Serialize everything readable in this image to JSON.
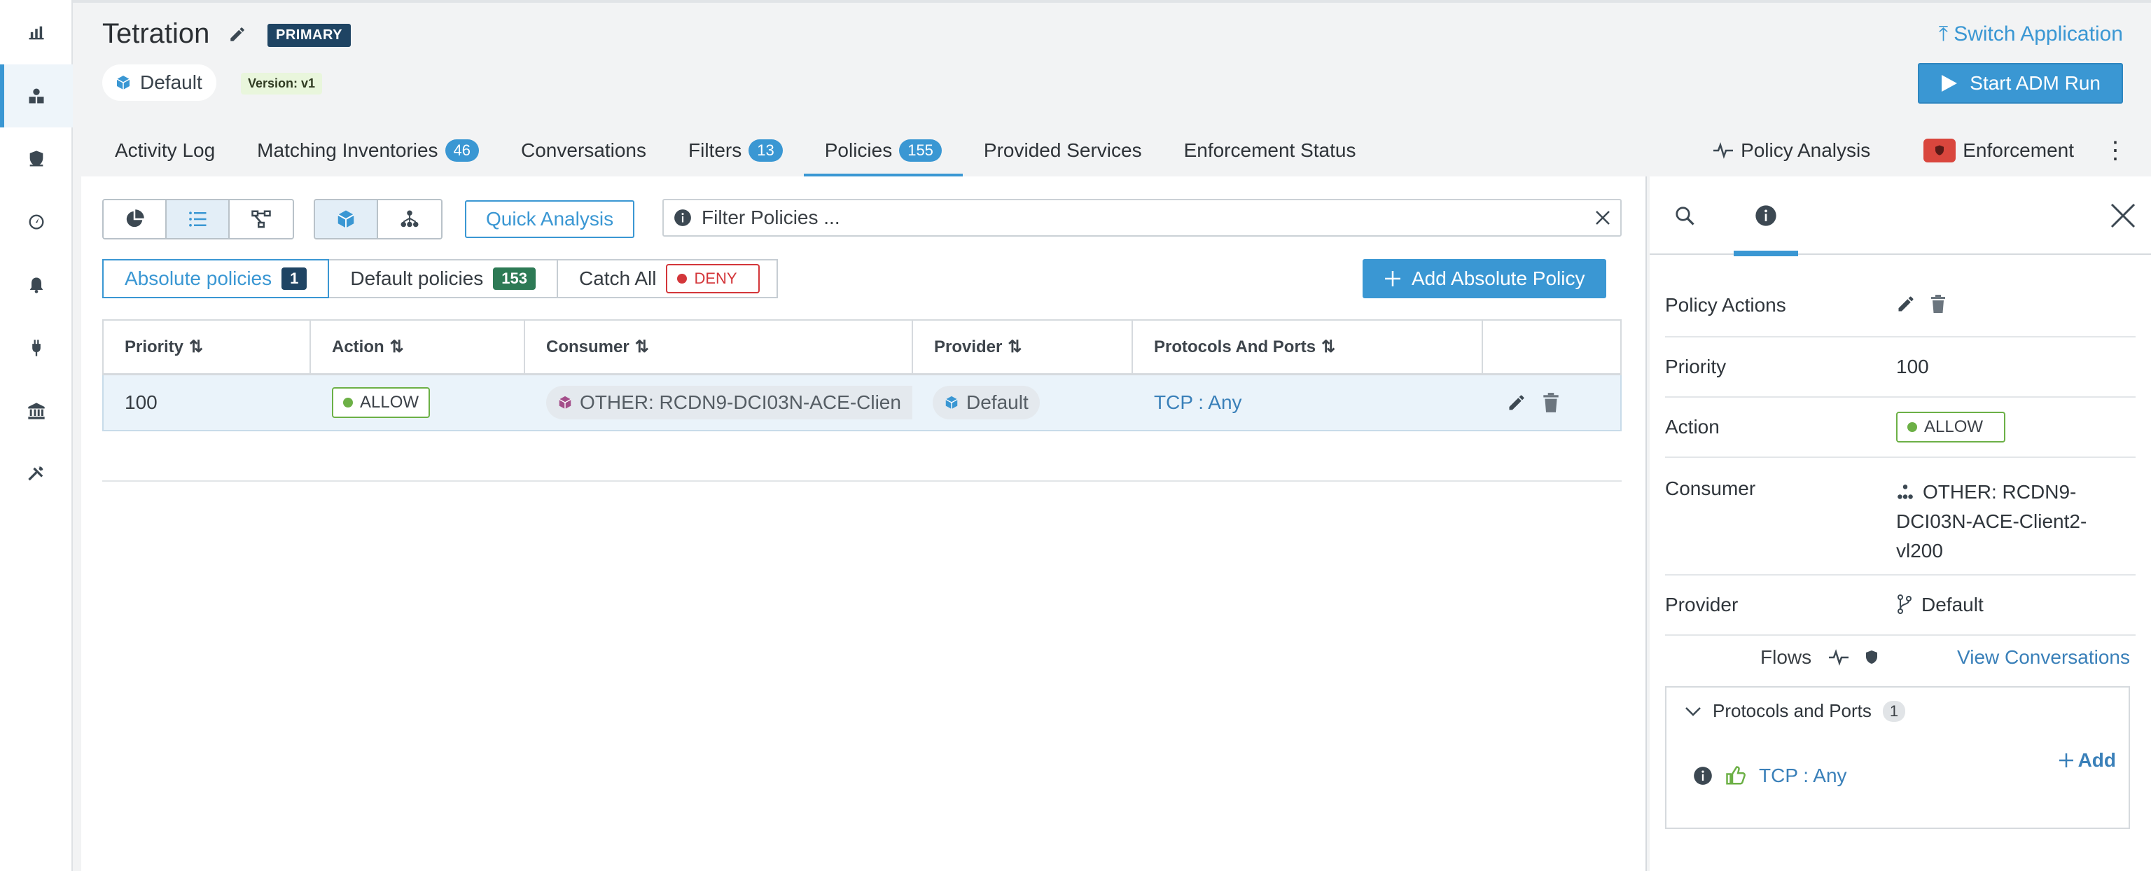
{
  "header": {
    "app_name": "Tetration",
    "primary_badge": "PRIMARY",
    "scope": "Default",
    "version": "Version: v1",
    "switch_app": "Switch Application",
    "start_adm": "Start ADM Run"
  },
  "tabs": [
    {
      "label": "Activity Log"
    },
    {
      "label": "Matching Inventories",
      "count": "46"
    },
    {
      "label": "Conversations"
    },
    {
      "label": "Filters",
      "count": "13"
    },
    {
      "label": "Policies",
      "count": "155"
    },
    {
      "label": "Provided Services"
    },
    {
      "label": "Enforcement Status"
    }
  ],
  "tabs_right": {
    "policy_analysis": "Policy Analysis",
    "enforcement": "Enforcement"
  },
  "toolbar": {
    "quick_analysis": "Quick Analysis",
    "filter_placeholder": "Filter Policies ..."
  },
  "policy_tabs": {
    "absolute": "Absolute policies",
    "absolute_count": "1",
    "default": "Default policies",
    "default_count": "153",
    "catch_all": "Catch All",
    "catch_all_value": "DENY",
    "add_button": "Add Absolute Policy"
  },
  "table": {
    "headers": [
      "Priority",
      "Action",
      "Consumer",
      "Provider",
      "Protocols And Ports"
    ],
    "rows": [
      {
        "priority": "100",
        "action": "ALLOW",
        "consumer": "OTHER: RCDN9-DCI03N-ACE-Clien",
        "provider": "Default",
        "ports": "TCP : Any"
      }
    ]
  },
  "detail": {
    "policy_actions_label": "Policy Actions",
    "priority_label": "Priority",
    "priority": "100",
    "action_label": "Action",
    "action": "ALLOW",
    "consumer_label": "Consumer",
    "consumer_line1": "OTHER: RCDN9-",
    "consumer_line2": "DCI03N-ACE-Client2-",
    "consumer_line3": "vl200",
    "provider_label": "Provider",
    "provider": "Default",
    "flows_label": "Flows",
    "view_conversations": "View Conversations",
    "protocols_title": "Protocols and Ports",
    "protocols_count": "1",
    "add": "Add",
    "protocol_item": "TCP : Any"
  },
  "colors": {
    "accent": "#3a97d3",
    "allow": "#6cb046",
    "deny": "#d3363a",
    "primary_badge": "#1f4463"
  }
}
